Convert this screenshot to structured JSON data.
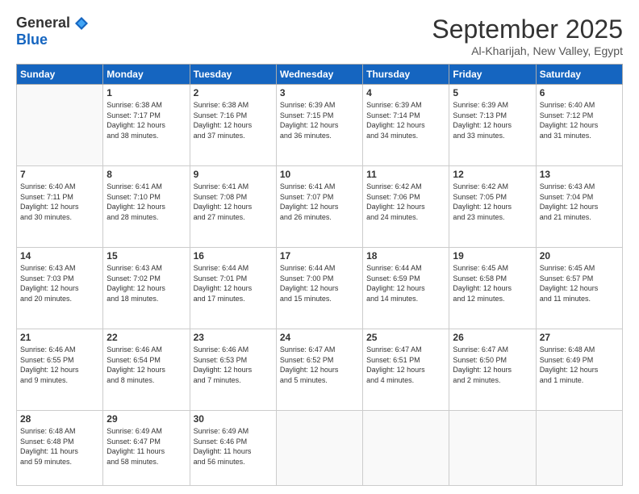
{
  "header": {
    "logo_general": "General",
    "logo_blue": "Blue",
    "month_title": "September 2025",
    "location": "Al-Kharijah, New Valley, Egypt"
  },
  "days_header": [
    "Sunday",
    "Monday",
    "Tuesday",
    "Wednesday",
    "Thursday",
    "Friday",
    "Saturday"
  ],
  "weeks": [
    [
      {
        "day": "",
        "info": ""
      },
      {
        "day": "1",
        "info": "Sunrise: 6:38 AM\nSunset: 7:17 PM\nDaylight: 12 hours\nand 38 minutes."
      },
      {
        "day": "2",
        "info": "Sunrise: 6:38 AM\nSunset: 7:16 PM\nDaylight: 12 hours\nand 37 minutes."
      },
      {
        "day": "3",
        "info": "Sunrise: 6:39 AM\nSunset: 7:15 PM\nDaylight: 12 hours\nand 36 minutes."
      },
      {
        "day": "4",
        "info": "Sunrise: 6:39 AM\nSunset: 7:14 PM\nDaylight: 12 hours\nand 34 minutes."
      },
      {
        "day": "5",
        "info": "Sunrise: 6:39 AM\nSunset: 7:13 PM\nDaylight: 12 hours\nand 33 minutes."
      },
      {
        "day": "6",
        "info": "Sunrise: 6:40 AM\nSunset: 7:12 PM\nDaylight: 12 hours\nand 31 minutes."
      }
    ],
    [
      {
        "day": "7",
        "info": "Sunrise: 6:40 AM\nSunset: 7:11 PM\nDaylight: 12 hours\nand 30 minutes."
      },
      {
        "day": "8",
        "info": "Sunrise: 6:41 AM\nSunset: 7:10 PM\nDaylight: 12 hours\nand 28 minutes."
      },
      {
        "day": "9",
        "info": "Sunrise: 6:41 AM\nSunset: 7:08 PM\nDaylight: 12 hours\nand 27 minutes."
      },
      {
        "day": "10",
        "info": "Sunrise: 6:41 AM\nSunset: 7:07 PM\nDaylight: 12 hours\nand 26 minutes."
      },
      {
        "day": "11",
        "info": "Sunrise: 6:42 AM\nSunset: 7:06 PM\nDaylight: 12 hours\nand 24 minutes."
      },
      {
        "day": "12",
        "info": "Sunrise: 6:42 AM\nSunset: 7:05 PM\nDaylight: 12 hours\nand 23 minutes."
      },
      {
        "day": "13",
        "info": "Sunrise: 6:43 AM\nSunset: 7:04 PM\nDaylight: 12 hours\nand 21 minutes."
      }
    ],
    [
      {
        "day": "14",
        "info": "Sunrise: 6:43 AM\nSunset: 7:03 PM\nDaylight: 12 hours\nand 20 minutes."
      },
      {
        "day": "15",
        "info": "Sunrise: 6:43 AM\nSunset: 7:02 PM\nDaylight: 12 hours\nand 18 minutes."
      },
      {
        "day": "16",
        "info": "Sunrise: 6:44 AM\nSunset: 7:01 PM\nDaylight: 12 hours\nand 17 minutes."
      },
      {
        "day": "17",
        "info": "Sunrise: 6:44 AM\nSunset: 7:00 PM\nDaylight: 12 hours\nand 15 minutes."
      },
      {
        "day": "18",
        "info": "Sunrise: 6:44 AM\nSunset: 6:59 PM\nDaylight: 12 hours\nand 14 minutes."
      },
      {
        "day": "19",
        "info": "Sunrise: 6:45 AM\nSunset: 6:58 PM\nDaylight: 12 hours\nand 12 minutes."
      },
      {
        "day": "20",
        "info": "Sunrise: 6:45 AM\nSunset: 6:57 PM\nDaylight: 12 hours\nand 11 minutes."
      }
    ],
    [
      {
        "day": "21",
        "info": "Sunrise: 6:46 AM\nSunset: 6:55 PM\nDaylight: 12 hours\nand 9 minutes."
      },
      {
        "day": "22",
        "info": "Sunrise: 6:46 AM\nSunset: 6:54 PM\nDaylight: 12 hours\nand 8 minutes."
      },
      {
        "day": "23",
        "info": "Sunrise: 6:46 AM\nSunset: 6:53 PM\nDaylight: 12 hours\nand 7 minutes."
      },
      {
        "day": "24",
        "info": "Sunrise: 6:47 AM\nSunset: 6:52 PM\nDaylight: 12 hours\nand 5 minutes."
      },
      {
        "day": "25",
        "info": "Sunrise: 6:47 AM\nSunset: 6:51 PM\nDaylight: 12 hours\nand 4 minutes."
      },
      {
        "day": "26",
        "info": "Sunrise: 6:47 AM\nSunset: 6:50 PM\nDaylight: 12 hours\nand 2 minutes."
      },
      {
        "day": "27",
        "info": "Sunrise: 6:48 AM\nSunset: 6:49 PM\nDaylight: 12 hours\nand 1 minute."
      }
    ],
    [
      {
        "day": "28",
        "info": "Sunrise: 6:48 AM\nSunset: 6:48 PM\nDaylight: 11 hours\nand 59 minutes."
      },
      {
        "day": "29",
        "info": "Sunrise: 6:49 AM\nSunset: 6:47 PM\nDaylight: 11 hours\nand 58 minutes."
      },
      {
        "day": "30",
        "info": "Sunrise: 6:49 AM\nSunset: 6:46 PM\nDaylight: 11 hours\nand 56 minutes."
      },
      {
        "day": "",
        "info": ""
      },
      {
        "day": "",
        "info": ""
      },
      {
        "day": "",
        "info": ""
      },
      {
        "day": "",
        "info": ""
      }
    ]
  ]
}
